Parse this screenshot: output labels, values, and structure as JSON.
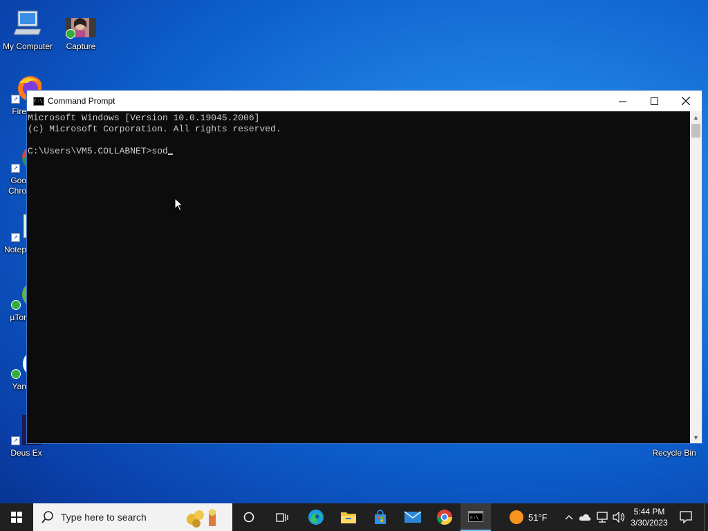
{
  "desktop": {
    "icons": [
      {
        "label": "My Computer"
      },
      {
        "label": "Capture"
      },
      {
        "label": "Fire"
      },
      {
        "label": "Goo Chro"
      },
      {
        "label": "Notep"
      },
      {
        "label": "µTor"
      },
      {
        "label": "Yan"
      },
      {
        "label": "Deus Ex"
      },
      {
        "label": "Recycle Bin"
      }
    ]
  },
  "window": {
    "title": "Command Prompt",
    "console_lines": [
      "Microsoft Windows [Version 10.0.19045.2006]",
      "(c) Microsoft Corporation. All rights reserved.",
      "",
      "C:\\Users\\VM5.COLLABNET>sod"
    ]
  },
  "taskbar": {
    "search_placeholder": "Type here to search",
    "apps": [
      "cortana-icon",
      "task-view-icon",
      "edge-icon",
      "file-explorer-icon",
      "store-icon",
      "mail-icon",
      "chrome-icon",
      "cmd-icon"
    ],
    "weather": "51°F",
    "time": "5:44 PM",
    "date": "3/30/2023"
  },
  "colors": {
    "accent": "#0a5fd0",
    "console_bg": "#0c0c0c",
    "console_fg": "#cccccc"
  }
}
